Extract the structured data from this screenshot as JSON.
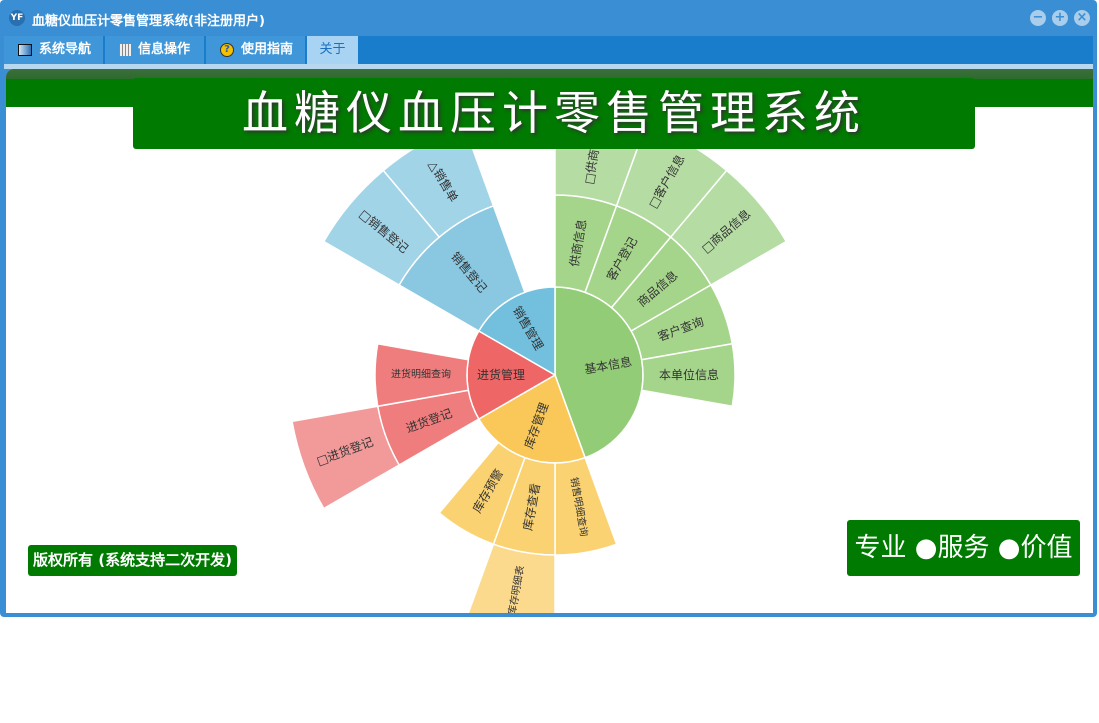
{
  "window": {
    "title": "血糖仪血压计零售管理系统(非注册用户)",
    "logo": "YF"
  },
  "tabs": [
    {
      "label": "系统导航",
      "icon": "monitor-icon"
    },
    {
      "label": "信息操作",
      "icon": "grid-icon"
    },
    {
      "label": "使用指南",
      "icon": "help-icon"
    },
    {
      "label": "关于",
      "icon": ""
    }
  ],
  "banner": {
    "title": "血糖仪血压计零售管理系统"
  },
  "footer": {
    "copyright": "版权所有 (系统支持二次开发)",
    "slogan": "专业 ●服务 ●价值"
  },
  "colors": {
    "green": [
      "#93cc76",
      "#a5d58b",
      "#b5dca3"
    ],
    "yellow": [
      "#fac858",
      "#fad272",
      "#fbda8e"
    ],
    "red": [
      "#ee6666",
      "#f07d7d",
      "#f29999"
    ],
    "blue": [
      "#73c0de",
      "#8ac8e2",
      "#a2d4e8"
    ]
  },
  "chart_data": {
    "type": "sunburst",
    "nodes": [
      {
        "name": "基本信息",
        "color": "green",
        "value": 8,
        "children": [
          {
            "name": "供商信息",
            "value": 1,
            "children": [
              {
                "name": "□供商信息",
                "value": 1
              }
            ]
          },
          {
            "name": "客户登记",
            "value": 1,
            "children": [
              {
                "name": "□客户信息",
                "value": 1
              }
            ]
          },
          {
            "name": "商品信息",
            "value": 1,
            "children": [
              {
                "name": "□商品信息",
                "value": 1
              }
            ]
          },
          {
            "name": "客户查询",
            "value": 1
          },
          {
            "name": "本单位信息",
            "value": 1
          }
        ]
      },
      {
        "name": "库存管理",
        "color": "yellow",
        "value": 4,
        "children": [
          {
            "name": "销售明细查询",
            "value": 1
          },
          {
            "name": "库存查看",
            "value": 1,
            "children": [
              {
                "name": "□库存明细表",
                "value": 1
              }
            ]
          },
          {
            "name": "库存预警",
            "value": 1
          }
        ]
      },
      {
        "name": "进货管理",
        "color": "red",
        "value": 3,
        "children": [
          {
            "name": "进货登记",
            "value": 1,
            "children": [
              {
                "name": "□进货登记",
                "value": 1
              }
            ]
          },
          {
            "name": "进货明细查询",
            "value": 1
          }
        ]
      },
      {
        "name": "销售管理",
        "color": "blue",
        "value": 3,
        "children": [
          {
            "name": "销售登记",
            "value": 2,
            "children": [
              {
                "name": "□销售登记",
                "value": 1
              },
              {
                "name": "△销售单",
                "value": 1
              }
            ]
          }
        ]
      }
    ]
  }
}
